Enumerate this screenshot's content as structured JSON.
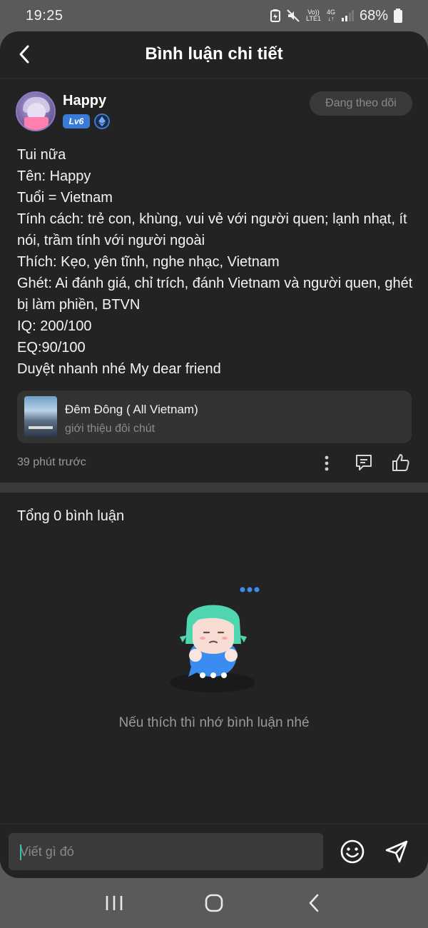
{
  "status_bar": {
    "time": "19:25",
    "network_top": "Vo))",
    "network_bottom": "LTE1",
    "data_type": "4G",
    "battery": "68%"
  },
  "header": {
    "title": "Bình luận chi tiết",
    "back_icon": "back-arrow-icon"
  },
  "post": {
    "author": {
      "name": "Happy",
      "level": "Lv6",
      "follow_label": "Đang theo dõi"
    },
    "lines": [
      "Tui nữa",
      "Tên: Happy",
      "Tuổi = Vietnam",
      "Tính cách: trẻ con, khùng, vui vẻ với người quen; lạnh nhạt, ít nói, trầm tính với người ngoài",
      "Thích: Kẹo, yên tĩnh, nghe nhạc, Vietnam",
      "Ghét: Ai đánh giá, chỉ trích, đánh Vietnam và người quen, ghét bị làm phiền, BTVN",
      "IQ: 200/100",
      "EQ:90/100",
      "Duyệt nhanh nhé My dear friend"
    ],
    "attachment": {
      "title": "Đêm Đông ( All Vietnam)",
      "subtitle": "giới thiệu đôi chút"
    },
    "time_ago": "39 phút trước"
  },
  "comments": {
    "count_label": "Tổng 0 bình luận",
    "empty_message": "Nếu thích thì nhớ bình luận nhé"
  },
  "composer": {
    "placeholder": "Viết gì đó"
  },
  "colors": {
    "background": "#232323",
    "accent_blue": "#3b7bd8",
    "cursor_teal": "#2fbfb4"
  }
}
